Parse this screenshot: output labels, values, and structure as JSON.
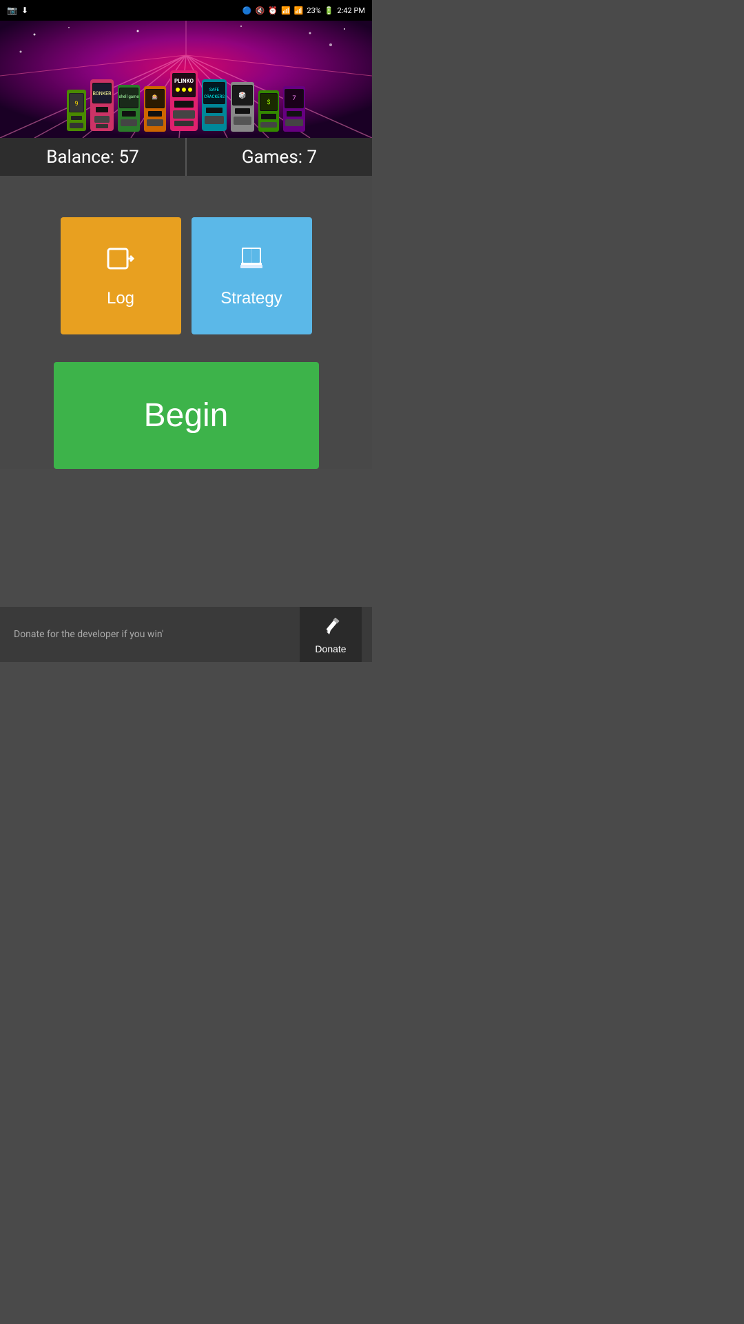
{
  "statusBar": {
    "time": "2:42 PM",
    "battery": "23%",
    "signal": "▲▲▲",
    "bluetooth": "BT",
    "wifi": "WiFi"
  },
  "banner": {
    "alt": "Casino slot machines"
  },
  "stats": {
    "balance_label": "Balance: 57",
    "games_label": "Games: 7"
  },
  "buttons": {
    "log_label": "Log",
    "strategy_label": "Strategy",
    "begin_label": "Begin"
  },
  "footer": {
    "donate_message": "Donate for the developer if you win'",
    "donate_button_label": "Donate"
  }
}
